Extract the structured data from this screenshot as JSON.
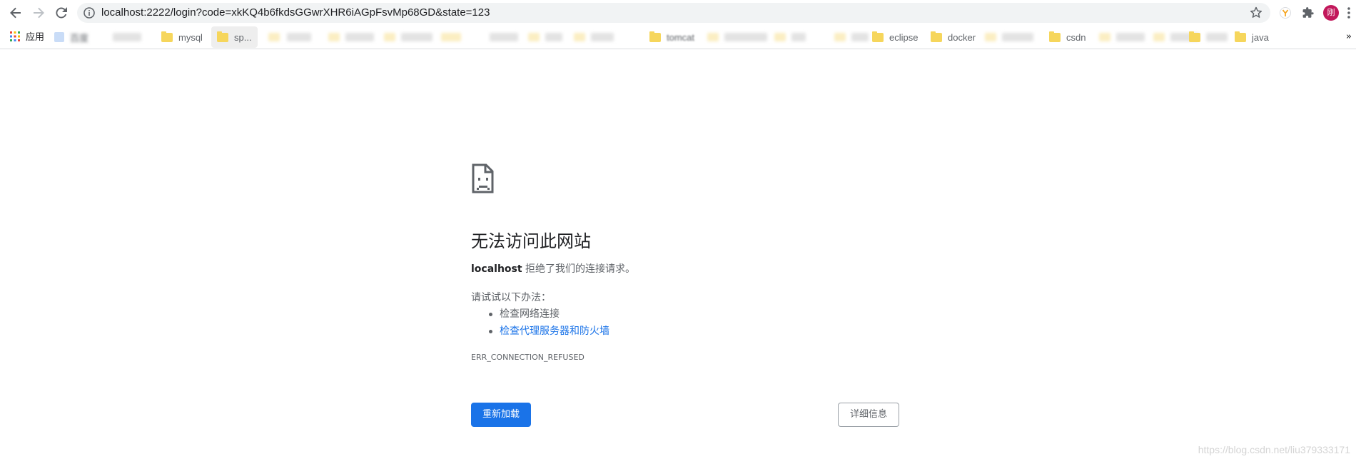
{
  "browser": {
    "url": "localhost:2222/login?code=xkKQ4b6fkdsGGwrXHR6iAGpFsvMp68GD&state=123",
    "profile_initial": "刚"
  },
  "bookmarks": {
    "apps_label": "应用",
    "items": [
      {
        "label": "百度",
        "icon": "page-icon"
      },
      {
        "label": "mysql",
        "icon": "folder-icon"
      },
      {
        "label": "sp...",
        "icon": "folder-icon"
      },
      {
        "label": "tomcat",
        "icon": "folder-icon"
      },
      {
        "label": "eclipse",
        "icon": "folder-icon"
      },
      {
        "label": "docker",
        "icon": "folder-icon"
      },
      {
        "label": "csdn",
        "icon": "folder-icon"
      },
      {
        "label": "java",
        "icon": "folder-icon"
      }
    ],
    "overflow": "»"
  },
  "error": {
    "title": "无法访问此网站",
    "host": "localhost",
    "message": " 拒绝了我们的连接请求。",
    "suggestions_heading": "请试试以下办法：",
    "suggestions": [
      {
        "text": "检查网络连接"
      },
      {
        "text": "检查代理服务器和防火墙"
      }
    ],
    "code": "ERR_CONNECTION_REFUSED",
    "reload_label": "重新加载",
    "details_label": "详细信息"
  },
  "watermark": "https://blog.csdn.net/liu379333171",
  "colors": {
    "accent": "#1a73e8",
    "avatar": "#c2185b",
    "folder": "#f6d65c"
  }
}
